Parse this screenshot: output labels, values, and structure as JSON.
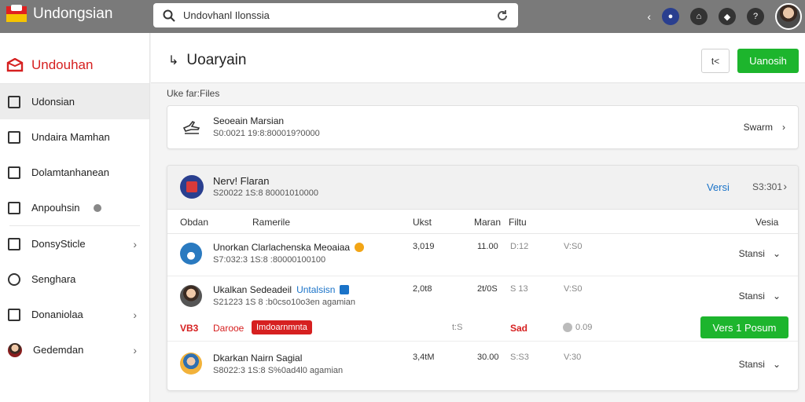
{
  "topbar": {
    "app_name": "Undongsian",
    "search_value": "Undovhanl Ilonssia",
    "icons": [
      "back-chevron-icon",
      "notification-icon",
      "lock-icon",
      "shield-icon",
      "help-icon"
    ]
  },
  "sidebar": {
    "brand": "Undouhan",
    "items": [
      {
        "label": "Udonsian",
        "icon": "page-icon",
        "active": true
      },
      {
        "label": "Undaira Mamhan",
        "icon": "document-icon"
      },
      {
        "label": "Dolamtanhanean",
        "icon": "list-icon"
      },
      {
        "label": "Anpouhsin",
        "icon": "terminal-icon",
        "badge": true
      },
      {
        "label": "DonsySticle",
        "icon": "grid-icon",
        "chevron": true
      },
      {
        "label": "Senghara",
        "icon": "circle-icon"
      },
      {
        "label": "Donaniolaa",
        "icon": "camera-icon",
        "chevron": true
      },
      {
        "label": "Gedemdan",
        "icon": "profile-icon",
        "chevron": true
      }
    ]
  },
  "header": {
    "title": "Uoaryain",
    "outline_button": "t<",
    "primary_button": "Uanosih"
  },
  "section_label": "Uke far:Files",
  "card1": {
    "title": "Seoeain Marsian",
    "subtitle": "S0:0021 19:8:800019?0000",
    "action": "Swarm"
  },
  "card2": {
    "title": "Nerv! Flaran",
    "subtitle": "S20022 1S:8 80001010000",
    "link": "Versi",
    "number": "S3:301",
    "columns": [
      "Obdan",
      "Ramerile",
      "Ukst",
      "Maran",
      "Filtu",
      "Vesia"
    ],
    "rows": [
      {
        "title": "Unorkan Clarlachenska Meoaiaa",
        "subtitle": "S7:032:3 1S:8 :80000100100",
        "c1": "3,019",
        "c2": "11.00",
        "c3": "D:12",
        "c4": "V:S0",
        "action": "Stansi"
      },
      {
        "title": "Ukalkan Sedeadeil",
        "title_link": "Untalsisn",
        "subtitle": "S21223 1S 8 :b0cso10o3en agamian",
        "c1": "2,0t8",
        "c2": "2t/0S",
        "c3": "S 13",
        "c4": "V:S0",
        "action": "Stansi"
      },
      {
        "title": "Dkarkan Nairn Sagial",
        "subtitle": "S8022:3 1S:8 S%0ad4l0 agamian",
        "c1": "3,4tM",
        "c2": "30.00",
        "c3": "S:S3",
        "c4": "V:30",
        "action": "Stansi"
      }
    ],
    "alert_row": {
      "code": "VB3",
      "label": "Darooe",
      "tag": "Imdoarnmnta",
      "c1": "t:S",
      "c2": "Sad",
      "c3": "0.09",
      "button": "Vers 1 Posum"
    }
  },
  "colors": {
    "accent": "#1db52d",
    "alert": "#d62020",
    "link": "#1a73c8"
  }
}
